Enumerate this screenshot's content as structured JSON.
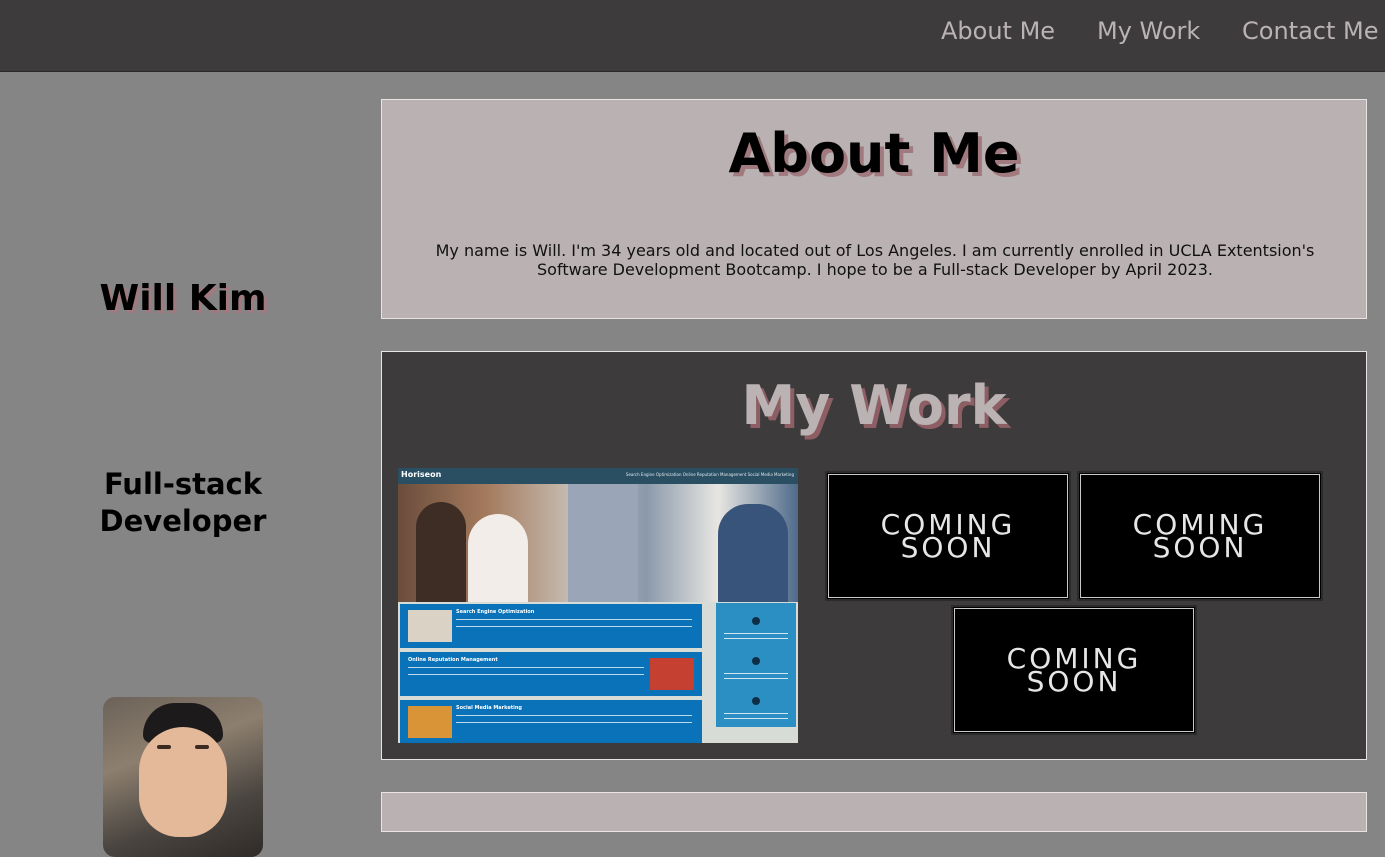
{
  "nav": {
    "about": "About Me",
    "work": "My Work",
    "contact": "Contact Me"
  },
  "sidebar": {
    "name": "Will Kim",
    "role": "Full-stack Developer"
  },
  "about": {
    "title": "About Me",
    "text": "My name is Will. I'm 34 years old and located out of Los Angeles. I am currently enrolled in UCLA Extentsion's Software Development Bootcamp. I hope to be a Full-stack Developer by April 2023."
  },
  "work": {
    "title": "My Work",
    "project_screenshot": {
      "logo": "Horiseon",
      "menu": "Search Engine Optimization     Online Reputation Management     Social Media Marketing",
      "cards": [
        "Search Engine Optimization",
        "Online Reputation Management",
        "Social Media Marketing"
      ]
    },
    "coming_soon": [
      {
        "line1": "COMING",
        "line2": "SOON"
      },
      {
        "line1": "COMING",
        "line2": "SOON"
      },
      {
        "line1": "COMING",
        "line2": "SOON"
      }
    ]
  },
  "colors": {
    "nav_bg": "#3d3b3c",
    "page_bg": "#858585",
    "about_bg": "#b9b1b2",
    "nav_text": "#bab2b3",
    "shadow_accent": "#a07a7e"
  }
}
